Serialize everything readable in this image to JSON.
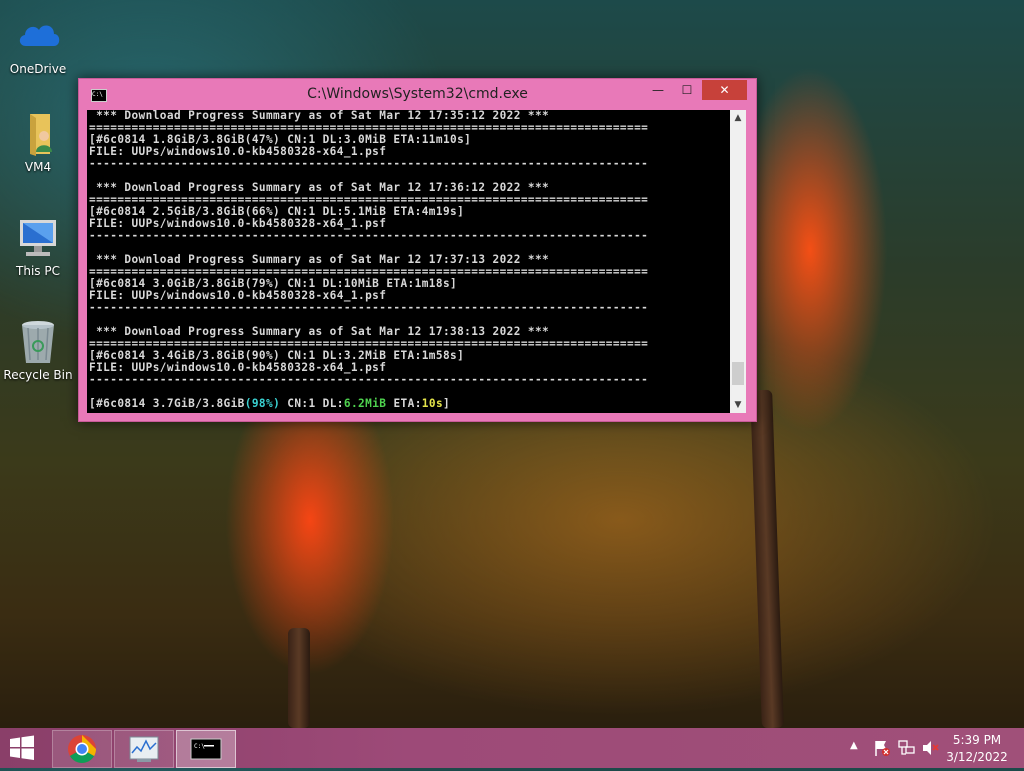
{
  "desktop": {
    "icons": [
      {
        "label": "OneDrive"
      },
      {
        "label": "VM4"
      },
      {
        "label": "This PC"
      },
      {
        "label": "Recycle Bin"
      }
    ]
  },
  "window": {
    "title": "C:\\Windows\\System32\\cmd.exe",
    "icon_text": "C:\\",
    "console_lines": [
      " *** Download Progress Summary as of Sat Mar 12 17:35:12 2022 ***",
      "===============================================================================",
      "[#6c0814 1.8GiB/3.8GiB(47%) CN:1 DL:3.0MiB ETA:11m10s]",
      "FILE: UUPs/windows10.0-kb4580328-x64_1.psf",
      "-------------------------------------------------------------------------------",
      "",
      " *** Download Progress Summary as of Sat Mar 12 17:36:12 2022 ***",
      "===============================================================================",
      "[#6c0814 2.5GiB/3.8GiB(66%) CN:1 DL:5.1MiB ETA:4m19s]",
      "FILE: UUPs/windows10.0-kb4580328-x64_1.psf",
      "-------------------------------------------------------------------------------",
      "",
      " *** Download Progress Summary as of Sat Mar 12 17:37:13 2022 ***",
      "===============================================================================",
      "[#6c0814 3.0GiB/3.8GiB(79%) CN:1 DL:10MiB ETA:1m18s]",
      "FILE: UUPs/windows10.0-kb4580328-x64_1.psf",
      "-------------------------------------------------------------------------------",
      "",
      " *** Download Progress Summary as of Sat Mar 12 17:38:13 2022 ***",
      "===============================================================================",
      "[#6c0814 3.4GiB/3.8GiB(90%) CN:1 DL:3.2MiB ETA:1m58s]",
      "FILE: UUPs/windows10.0-kb4580328-x64_1.psf",
      "-------------------------------------------------------------------------------",
      ""
    ],
    "status_line": {
      "open": "[",
      "id": "#6c0814",
      "sizes": " 3.7GiB/3.8GiB",
      "pct": "(98%)",
      "cn": " CN:1 DL:",
      "dl": "6.2MiB",
      "eta_label": " ETA:",
      "eta": "10s",
      "close": "]"
    },
    "scroll_position": 0.95
  },
  "taskbar": {
    "time": "5:39 PM",
    "date": "3/12/2022",
    "items": [
      "chrome-icon",
      "performance-monitor-icon",
      "cmd-icon"
    ]
  },
  "colors": {
    "window_frame": "#e879b8",
    "close_button": "#c7413a",
    "taskbar": "#9d4a78"
  }
}
